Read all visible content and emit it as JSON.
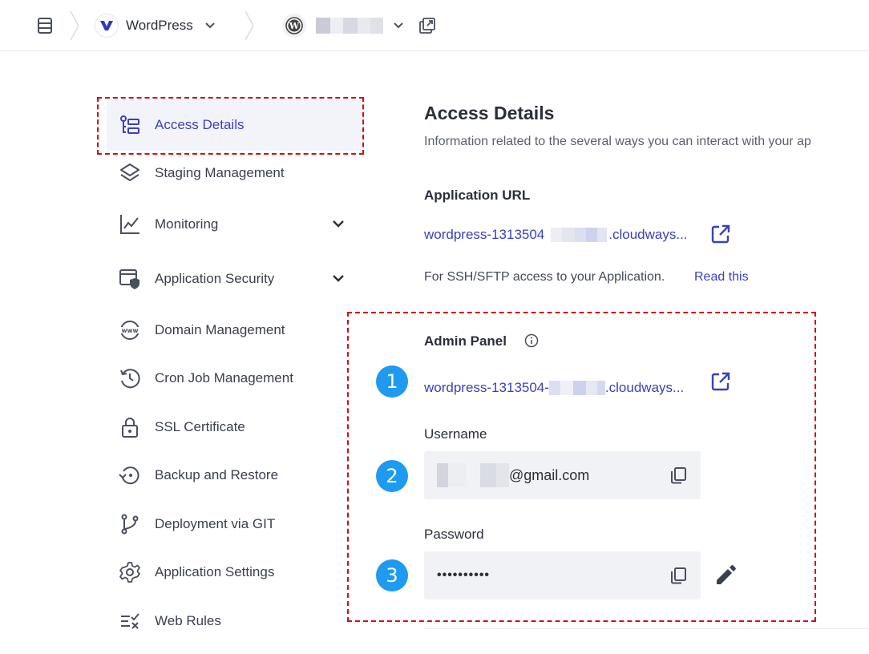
{
  "topbar": {
    "menu_icon": "list-icon",
    "app_name": "WordPress",
    "app_icon": "cloudways-logo-icon",
    "site_icon": "wordpress-logo-icon",
    "site_chevron_icon": "chevron-down-icon",
    "open_new_icon": "external-window-icon"
  },
  "sidebar": {
    "items": [
      {
        "label": "Access Details",
        "icon": "access-details-icon",
        "active": true
      },
      {
        "label": "Staging Management",
        "icon": "layers-icon"
      },
      {
        "label": "Monitoring",
        "icon": "chart-icon",
        "expandable": true
      },
      {
        "label": "Application Security",
        "icon": "shield-window-icon",
        "expandable": true
      },
      {
        "label": "Domain Management",
        "icon": "www-icon"
      },
      {
        "label": "Cron Job Management",
        "icon": "history-icon"
      },
      {
        "label": "SSL Certificate",
        "icon": "lock-icon"
      },
      {
        "label": "Backup and Restore",
        "icon": "backup-icon"
      },
      {
        "label": "Deployment via GIT",
        "icon": "git-branch-icon"
      },
      {
        "label": "Application Settings",
        "icon": "gear-icon"
      },
      {
        "label": "Web Rules",
        "icon": "web-rules-icon"
      }
    ]
  },
  "main": {
    "title": "Access Details",
    "subtitle": "Information related to the several ways you can interact with your ap",
    "app_url": {
      "title": "Application URL",
      "url_prefix": "wordpress-1313504",
      "url_suffix": ".cloudways...",
      "ssh_note": "For SSH/SFTP access to your Application.",
      "read_this": "Read this"
    },
    "admin_panel": {
      "title": "Admin Panel",
      "url_prefix": "wordpress-1313504-",
      "url_suffix": ".cloudways...",
      "username_label": "Username",
      "username_suffix": "@gmail.com",
      "password_label": "Password",
      "password_value": "••••••••••"
    },
    "steps": [
      "1",
      "2",
      "3"
    ]
  },
  "colors": {
    "accent": "#3b3fbf",
    "badge": "#1e9bf0",
    "highlight": "#cc1111"
  }
}
